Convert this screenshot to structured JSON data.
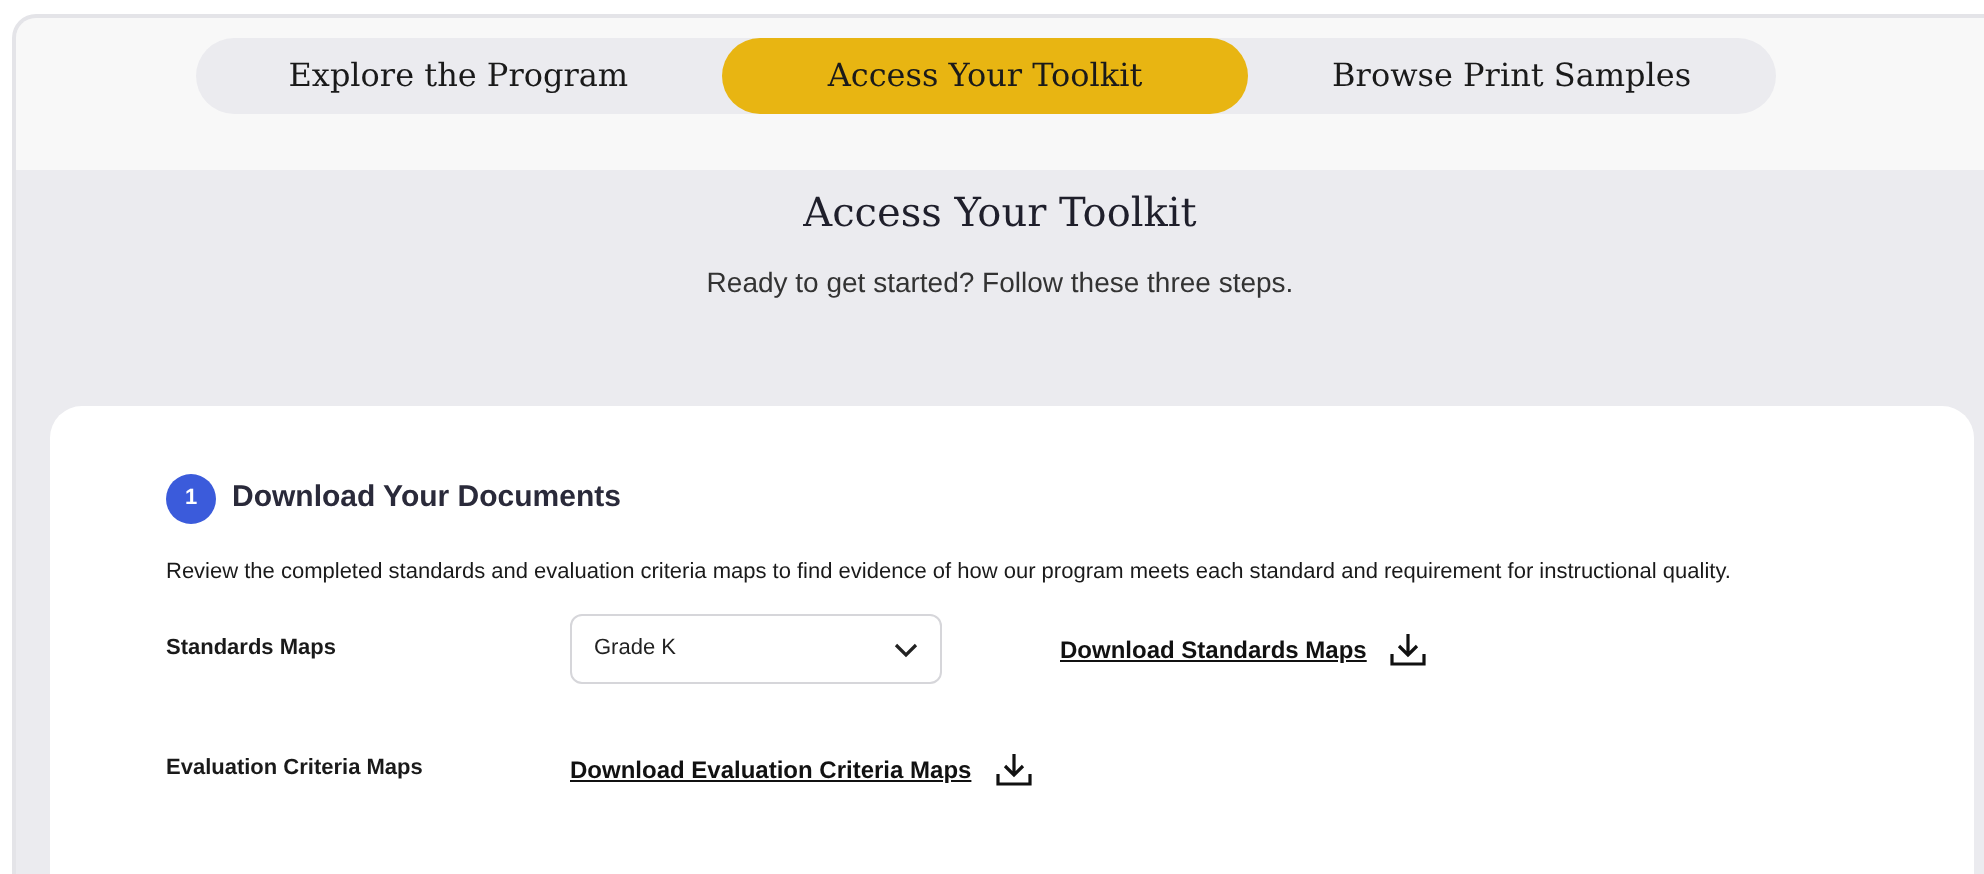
{
  "tabs": [
    {
      "label": "Explore the Program",
      "selected": false
    },
    {
      "label": "Access Your Toolkit",
      "selected": true
    },
    {
      "label": "Browse Print Samples",
      "selected": false
    }
  ],
  "heading": "Access Your Toolkit",
  "subheading": "Ready to get started? Follow these three steps.",
  "step": {
    "number": "1",
    "title": "Download Your Documents",
    "description": "Review the completed standards and evaluation criteria maps to find evidence of how our program meets each standard and requirement for instructional quality.",
    "rows": [
      {
        "kind": "select",
        "label": "Standards Maps",
        "value": "Grade K",
        "link": "Download Standards Maps"
      },
      {
        "kind": "link",
        "label": "Evaluation Criteria Maps",
        "link": "Download Evaluation Criteria Maps"
      }
    ]
  }
}
